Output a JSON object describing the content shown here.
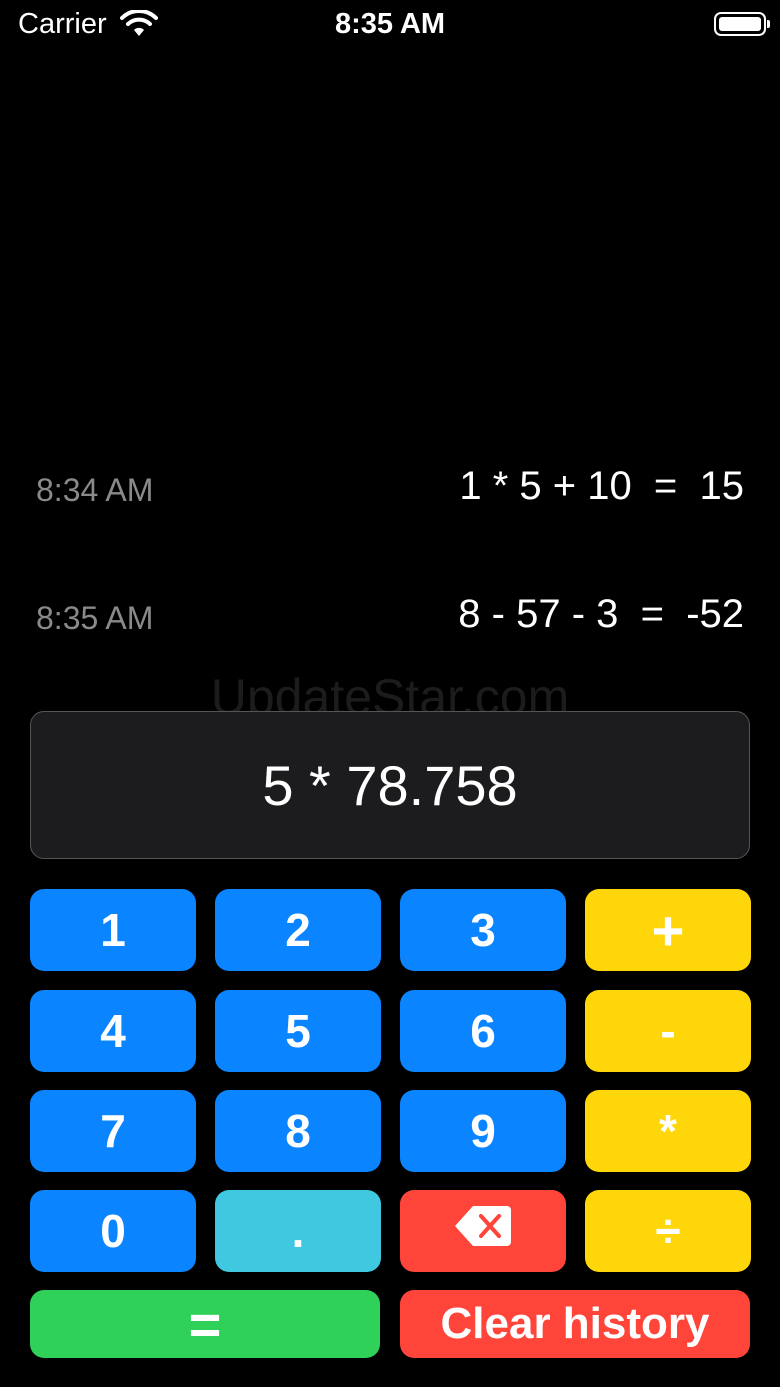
{
  "status_bar": {
    "carrier": "Carrier",
    "time": "8:35 AM"
  },
  "history": [
    {
      "time": "8:34 AM",
      "expression": "1 * 5 + 10  =  15"
    },
    {
      "time": "8:35 AM",
      "expression": "8 - 57 - 3  =  -52"
    }
  ],
  "watermark": "UpdateStar.com",
  "display": {
    "value": "5 * 78.758"
  },
  "keys": {
    "k1": "1",
    "k2": "2",
    "k3": "3",
    "plus": "+",
    "k4": "4",
    "k5": "5",
    "k6": "6",
    "minus": "-",
    "k7": "7",
    "k8": "8",
    "k9": "9",
    "multiply": "*",
    "k0": "0",
    "decimal": ".",
    "divide": "÷",
    "equals": "=",
    "clear_history": "Clear history"
  },
  "colors": {
    "digit": "#0a84ff",
    "operator": "#ffd60a",
    "decimal": "#40c8e0",
    "delete": "#ff453a",
    "equals": "#30d158",
    "clear": "#ff453a"
  },
  "icons": {
    "wifi": "wifi-icon",
    "battery": "battery-icon",
    "delete": "backspace-icon"
  }
}
